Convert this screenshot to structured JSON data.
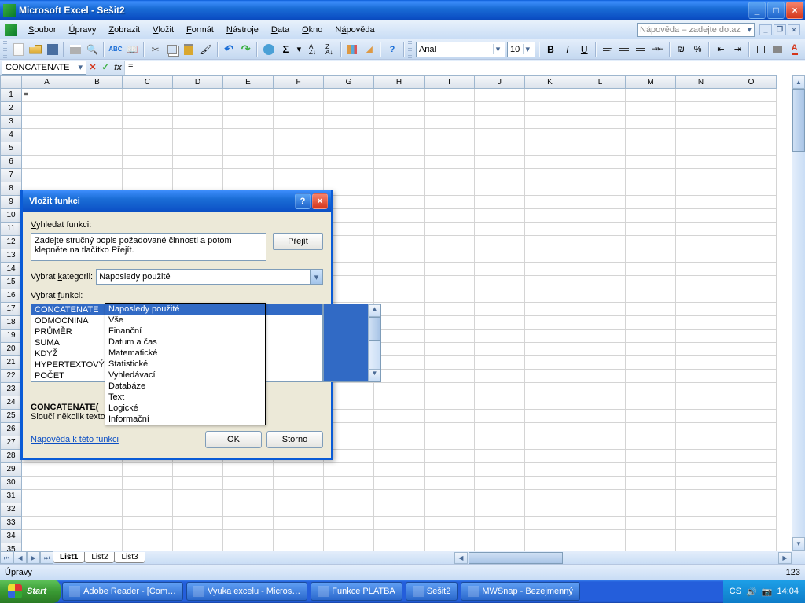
{
  "app": {
    "title": "Microsoft Excel - Sešit2"
  },
  "menu": [
    "Soubor",
    "Úpravy",
    "Zobrazit",
    "Vložit",
    "Formát",
    "Nástroje",
    "Data",
    "Okno",
    "Nápověda"
  ],
  "menu_accel": [
    "S",
    "Ú",
    "Z",
    "V",
    "F",
    "N",
    "D",
    "O",
    "á"
  ],
  "askhelp_placeholder": "Nápověda – zadejte dotaz",
  "font": {
    "name": "Arial",
    "size": "10"
  },
  "namebox": "CONCATENATE",
  "formula": "=",
  "cellA1": "=",
  "columns": [
    "A",
    "B",
    "C",
    "D",
    "E",
    "F",
    "G",
    "H",
    "I",
    "J",
    "K",
    "L",
    "M",
    "N",
    "O"
  ],
  "tabs": [
    "List1",
    "List2",
    "List3"
  ],
  "active_tab": 0,
  "status_left": "Úpravy",
  "status_right": "123",
  "dialog": {
    "title": "Vložit funkci",
    "search_label": "Vyhledat funkci:",
    "search_text": "Zadejte stručný popis požadované činnosti a potom klepněte na tlačítko Přejít.",
    "go": "Přejít",
    "cat_label": "Vybrat kategorii:",
    "cat_value": "Naposledy použité",
    "cat_options": [
      "Naposledy použité",
      "Vše",
      "Finanční",
      "Datum a čas",
      "Matematické",
      "Statistické",
      "Vyhledávací",
      "Databáze",
      "Text",
      "Logické",
      "Informační"
    ],
    "select_fn_label": "Vybrat funkci:",
    "functions": [
      "CONCATENATE",
      "ODMOCNINA",
      "PRŮMĚR",
      "SUMA",
      "KDYŽ",
      "HYPERTEXTOVÝ.",
      "POČET"
    ],
    "fn_sig": "CONCATENATE(",
    "fn_desc": "Sloučí několik textových řetězců do jednoho.",
    "help_link": "Nápověda k této funkci",
    "ok": "OK",
    "cancel": "Storno"
  },
  "taskbar": {
    "start": "Start",
    "items": [
      "Adobe Reader - [Com…",
      "Vyuka excelu - Micros…",
      "Funkce PLATBA",
      "Sešit2",
      "MWSnap - Bezejmenný"
    ],
    "tray_lang": "CS",
    "clock": "14:04"
  }
}
